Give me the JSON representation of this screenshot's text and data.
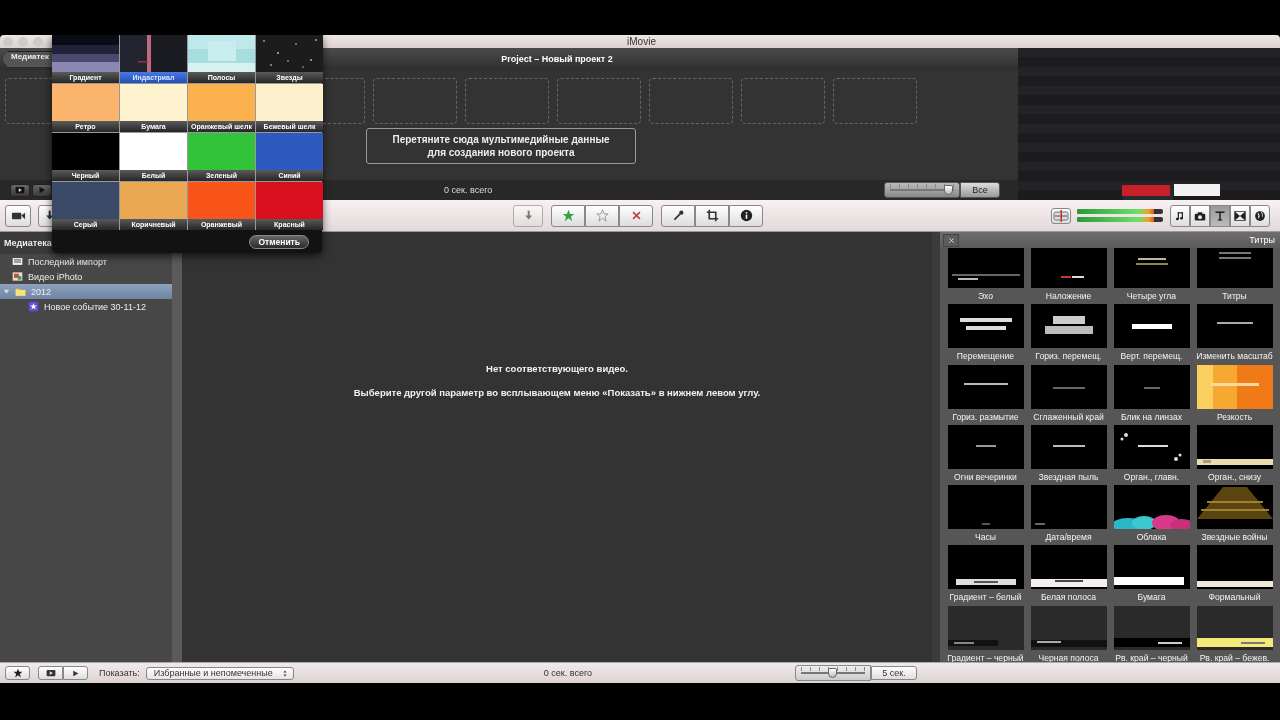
{
  "window": {
    "title": "iMovie"
  },
  "project": {
    "back_button": "Медиатек",
    "title": "Project – Новый проект 2",
    "drop_hint": "Перетяните сюда мультимедийные данные\nдля создания нового проекта",
    "total": "0 сек. всего",
    "zoom": {
      "level": 0.92
    },
    "zoom_button": "Все"
  },
  "toolbar": {
    "audio_meters": [
      {
        "level": 0.9
      },
      {
        "level": 0.9
      }
    ],
    "browser_tabs": [
      {
        "kind": "music",
        "selected": false
      },
      {
        "kind": "photos",
        "selected": false
      },
      {
        "kind": "titles",
        "selected": true
      },
      {
        "kind": "transitions",
        "selected": false
      },
      {
        "kind": "maps",
        "selected": false
      }
    ]
  },
  "sidebar": {
    "header": "Медиатека",
    "items": [
      {
        "label": "Последний импорт",
        "kind": "import",
        "selected": false
      },
      {
        "label": "Видео iPhoto",
        "kind": "iphoto",
        "selected": false
      },
      {
        "label": "2012",
        "kind": "folder",
        "selected": true,
        "expanded": true,
        "children": [
          {
            "label": "Новое событие 30-11-12",
            "kind": "event",
            "selected": false
          }
        ]
      }
    ]
  },
  "events": {
    "messages": [
      "Нет соответствующего видео.",
      "Выберите другой параметр во всплывающем меню «Показать» в нижнем левом углу."
    ]
  },
  "titles_browser": {
    "title": "Титры",
    "items": [
      {
        "label": "Эхо"
      },
      {
        "label": "Наложение"
      },
      {
        "label": "Четыре угла"
      },
      {
        "label": "Титры"
      },
      {
        "label": "Перемещение"
      },
      {
        "label": "Гориз. перемещ."
      },
      {
        "label": "Верт. перемещ."
      },
      {
        "label": "Изменить масштаб"
      },
      {
        "label": "Гориз. размытие"
      },
      {
        "label": "Сглаженный край"
      },
      {
        "label": "Блик на линзах"
      },
      {
        "label": "Резкость"
      },
      {
        "label": "Огни вечеринки"
      },
      {
        "label": "Звездная пыль"
      },
      {
        "label": "Орган., главн."
      },
      {
        "label": "Орган., снизу"
      },
      {
        "label": "Часы"
      },
      {
        "label": "Дата/время"
      },
      {
        "label": "Облака"
      },
      {
        "label": "Звездные войны"
      },
      {
        "label": "Градиент – белый"
      },
      {
        "label": "Белая полоса"
      },
      {
        "label": "Бумага"
      },
      {
        "label": "Формальный"
      },
      {
        "label": "Градиент – черный"
      },
      {
        "label": "Черная полоса"
      },
      {
        "label": "Рв. край – черный"
      },
      {
        "label": "Рв. край – бежев."
      }
    ]
  },
  "bottom_bar": {
    "show_label": "Показать:",
    "show_menu": "Избранные и непомеченные",
    "total": "0 сек. всего",
    "zoom": {
      "level": 0.5
    },
    "duration_button": "5 сек."
  },
  "theme_popup": {
    "items": [
      {
        "label": "Градиент",
        "kind": "picture",
        "selected": false
      },
      {
        "label": "Индастриал",
        "kind": "picture",
        "selected": true
      },
      {
        "label": "Полосы",
        "kind": "picture",
        "selected": false
      },
      {
        "label": "Звезды",
        "kind": "picture",
        "selected": false
      },
      {
        "label": "Ретро",
        "kind": "color",
        "color": "#fbb46c",
        "selected": false
      },
      {
        "label": "Бумага",
        "kind": "color",
        "color": "#fdf3cf",
        "selected": false
      },
      {
        "label": "Оранжевый шелк",
        "kind": "color",
        "color": "#fbb24e",
        "selected": false
      },
      {
        "label": "Бежевый шелк",
        "kind": "color",
        "color": "#fdf0cc",
        "selected": false
      },
      {
        "label": "Черный",
        "kind": "color",
        "color": "#000000",
        "selected": false
      },
      {
        "label": "Белый",
        "kind": "color",
        "color": "#ffffff",
        "selected": false
      },
      {
        "label": "Зеленый",
        "kind": "color",
        "color": "#33c33a",
        "selected": false
      },
      {
        "label": "Синий",
        "kind": "color",
        "color": "#2e5ac0",
        "selected": false
      },
      {
        "label": "Серый",
        "kind": "color",
        "color": "#3a4a66",
        "selected": false
      },
      {
        "label": "Коричневый",
        "kind": "color",
        "color": "#eaa852",
        "selected": false
      },
      {
        "label": "Оранжевый",
        "kind": "color",
        "color": "#f9541a",
        "selected": false
      },
      {
        "label": "Красный",
        "kind": "color",
        "color": "#d8101e",
        "selected": false
      }
    ],
    "cancel_button": "Отменить"
  }
}
